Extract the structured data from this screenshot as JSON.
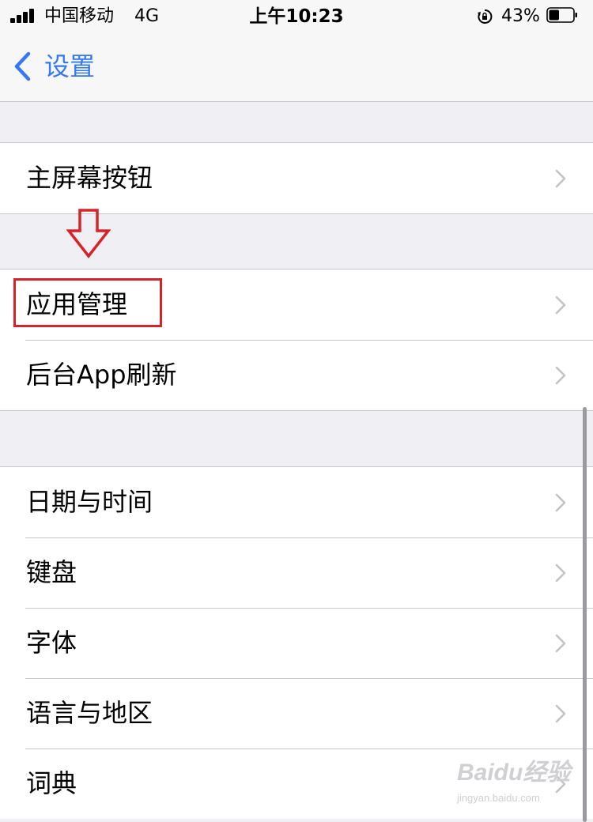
{
  "status_bar": {
    "carrier": "中国移动",
    "network": "4G",
    "time": "上午10:23",
    "battery_percent": "43%",
    "battery_level": 0.43,
    "signal_bars": 4,
    "icons": [
      "signal-icon",
      "orientation-lock-icon",
      "battery-icon"
    ]
  },
  "nav": {
    "back_label": "设置",
    "back_icon": "chevron-left-icon",
    "accent_color": "#3478f6"
  },
  "groups": [
    {
      "items": [
        {
          "label": "主屏幕按钮"
        }
      ]
    },
    {
      "items": [
        {
          "label": "应用管理"
        },
        {
          "label": "后台App刷新"
        }
      ]
    },
    {
      "items": [
        {
          "label": "日期与时间"
        },
        {
          "label": "键盘"
        },
        {
          "label": "字体"
        },
        {
          "label": "语言与地区"
        },
        {
          "label": "词典"
        }
      ]
    }
  ],
  "annotation": {
    "highlighted_item": "应用管理",
    "highlight_color": "#d8222a",
    "arrow_icon": "down-arrow-icon"
  },
  "watermark": {
    "logo": "Baidu经验",
    "url": "jingyan.baidu.com"
  }
}
